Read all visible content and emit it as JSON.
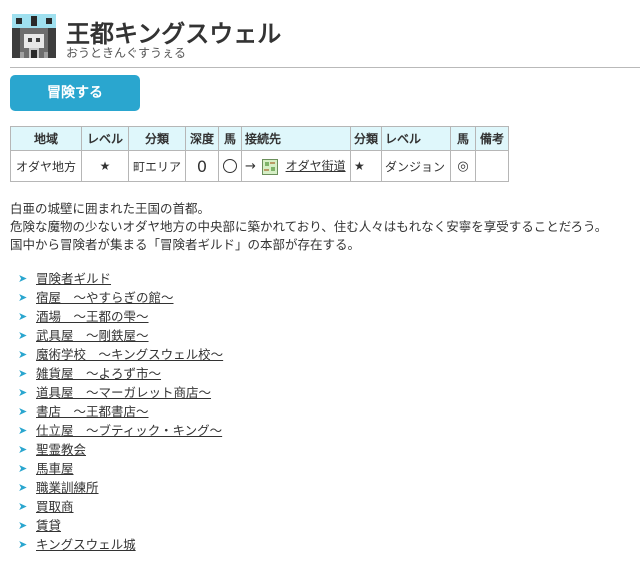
{
  "header": {
    "title": "王都キングスウェル",
    "reading": "おうときんぐすうぇる"
  },
  "adventure_button": "冒険する",
  "info_table": {
    "headers": [
      "地域",
      "レベル",
      "分類",
      "深度",
      "馬",
      "接続先",
      "分類",
      "レベル",
      "馬",
      "備考"
    ],
    "row": {
      "region": "オダヤ地方",
      "level": "★",
      "category": "町エリア",
      "depth": "0",
      "horse": "◯",
      "arrow": "→",
      "destination": "オダヤ街道",
      "dest_level": "★",
      "dest_category": "ダンジョン",
      "dest_horse": "◎",
      "note": ""
    }
  },
  "description": [
    "白亜の城壁に囲まれた王国の首都。",
    "危険な魔物の少ないオダヤ地方の中央部に築かれており、住む人々はもれなく安寧を享受することだろう。",
    "国中から冒険者が集まる「冒険者ギルド」の本部が存在する。"
  ],
  "places": [
    "冒険者ギルド",
    "宿屋　～やすらぎの館～",
    "酒場　～王都の雫～",
    "武具屋　～剛鉄屋～",
    "魔術学校　～キングスウェル校～",
    "雑貨屋　～よろず市～",
    "道具屋　～マーガレット商店～",
    "書店　～王都書店～",
    "仕立屋　～ブティック・キング～",
    "聖霊教会",
    "馬車屋",
    "職業訓練所",
    "買取商",
    "賃貸",
    "キングスウェル城"
  ],
  "colors": {
    "accent": "#2aa6cf",
    "table_header_bg": "#dff7fb"
  }
}
